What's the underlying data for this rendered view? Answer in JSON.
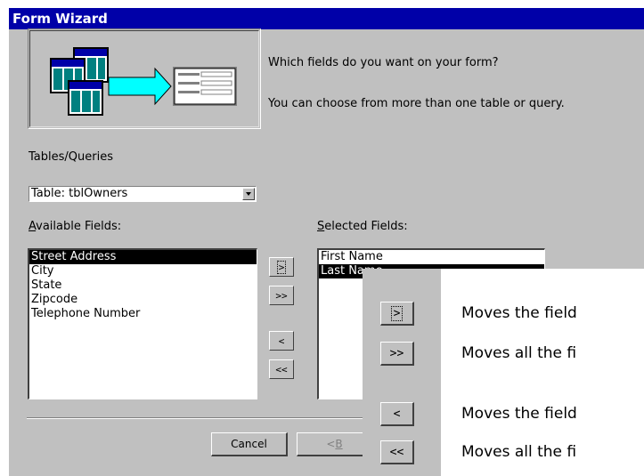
{
  "window": {
    "title": "Form Wizard"
  },
  "prompt": {
    "line1": "Which fields do you want on your form?",
    "line2": "You can choose from more than one table or query."
  },
  "tables_queries": {
    "label": "Tables/Queries",
    "selected": "Table: tblOwners"
  },
  "available_fields": {
    "label_accel": "A",
    "label_rest": "vailable Fields:",
    "items": [
      "Street Address",
      "City",
      "State",
      "Zipcode",
      "Telephone Number"
    ],
    "selected_index": 0
  },
  "selected_fields": {
    "label_accel": "S",
    "label_rest": "elected Fields:",
    "items": [
      "First Name",
      "Last Name"
    ],
    "selected_index": 1
  },
  "move_buttons": {
    "one_right": ">",
    "all_right": ">>",
    "one_left": "<",
    "all_left": "<<"
  },
  "footer": {
    "cancel": "Cancel",
    "back_prefix": "< ",
    "back_accel": "B"
  },
  "callout": {
    "one_right_text": "Moves the field",
    "all_right_text": "Moves all the fi",
    "one_left_text": "Moves the field",
    "all_left_text": "Moves all the fi"
  }
}
